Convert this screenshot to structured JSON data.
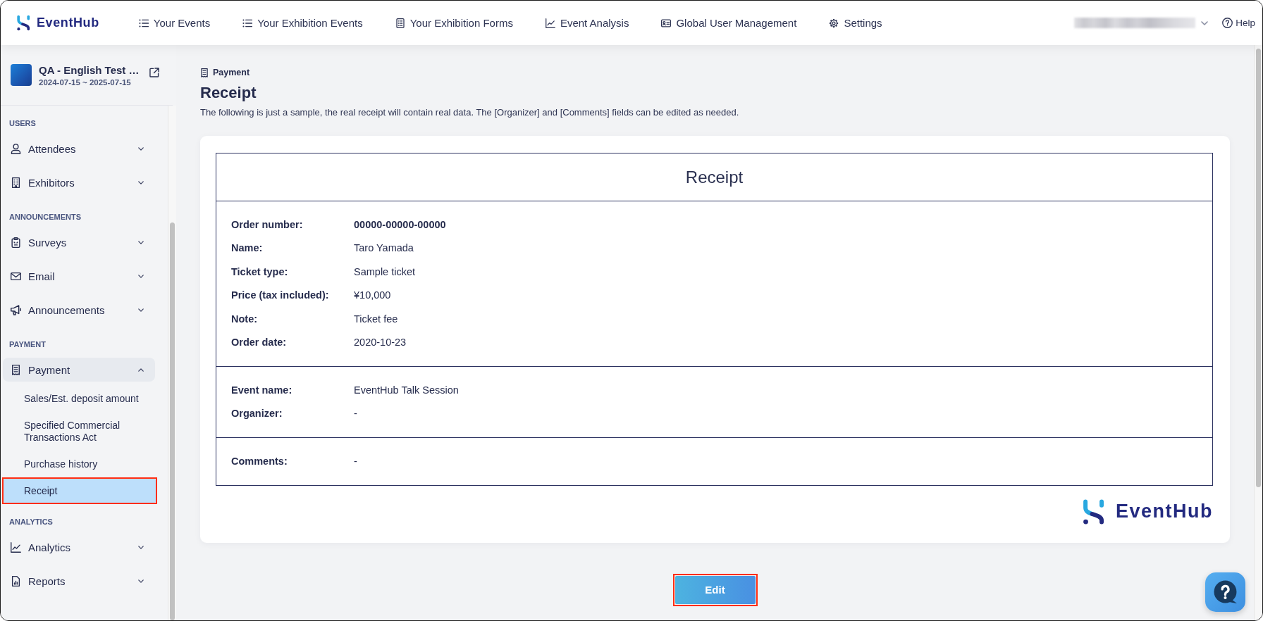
{
  "header": {
    "logo_text": "EventHub",
    "nav": [
      {
        "label": "Your Events"
      },
      {
        "label": "Your Exhibition Events"
      },
      {
        "label": "Your Exhibition Forms"
      },
      {
        "label": "Event Analysis"
      },
      {
        "label": "Global User Management"
      },
      {
        "label": "Settings"
      }
    ],
    "help": "Help"
  },
  "sidebar": {
    "event": {
      "title": "QA - English Test …",
      "dates": "2024-07-15 ~ 2025-07-15"
    },
    "sections": [
      {
        "heading": "USERS",
        "items": [
          {
            "label": "Attendees",
            "expanded": false
          },
          {
            "label": "Exhibitors",
            "expanded": false
          }
        ]
      },
      {
        "heading": "ANNOUNCEMENTS",
        "items": [
          {
            "label": "Surveys",
            "expanded": false
          },
          {
            "label": "Email",
            "expanded": false
          },
          {
            "label": "Announcements",
            "expanded": false
          }
        ]
      },
      {
        "heading": "PAYMENT",
        "items": [
          {
            "label": "Payment",
            "expanded": true,
            "children": [
              {
                "label": "Sales/Est. deposit amount",
                "selected": false,
                "highlighted": false
              },
              {
                "label": "Specified Commercial Transactions Act",
                "selected": false,
                "highlighted": false
              },
              {
                "label": "Purchase history",
                "selected": false,
                "highlighted": false
              },
              {
                "label": "Receipt",
                "selected": true,
                "highlighted": true
              }
            ]
          }
        ]
      },
      {
        "heading": "ANALYTICS",
        "items": [
          {
            "label": "Analytics",
            "expanded": false
          },
          {
            "label": "Reports",
            "expanded": false
          }
        ]
      }
    ]
  },
  "page": {
    "breadcrumb": "Payment",
    "title": "Receipt",
    "description": "The following is just a sample, the real receipt will contain real data. The [Organizer] and [Comments] fields can be edited as needed."
  },
  "receipt": {
    "title": "Receipt",
    "sections": [
      {
        "rows": [
          {
            "label": "Order number:",
            "value": "00000-00000-00000",
            "emphasis": true
          },
          {
            "label": "Name:",
            "value": "Taro Yamada",
            "emphasis": false
          },
          {
            "label": "Ticket type:",
            "value": "Sample ticket",
            "emphasis": false
          },
          {
            "label": "Price (tax included):",
            "value": "¥10,000",
            "emphasis": false
          },
          {
            "label": "Note:",
            "value": "Ticket fee",
            "emphasis": false
          },
          {
            "label": "Order date:",
            "value": "2020-10-23",
            "emphasis": false
          }
        ]
      },
      {
        "rows": [
          {
            "label": "Event name:",
            "value": "EventHub Talk Session",
            "emphasis": false
          },
          {
            "label": "Organizer:",
            "value": "-",
            "emphasis": false
          }
        ]
      },
      {
        "rows": [
          {
            "label": "Comments:",
            "value": "-",
            "emphasis": false
          }
        ]
      }
    ],
    "logo_text": "EventHub"
  },
  "edit_button": {
    "label": "Edit",
    "highlighted": true
  }
}
